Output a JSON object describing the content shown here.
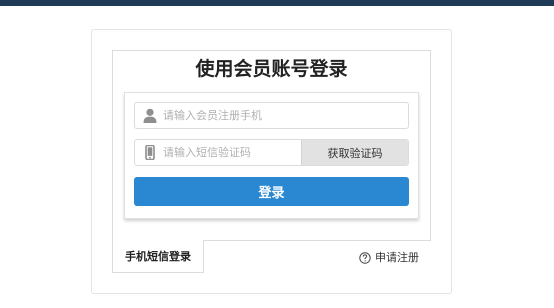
{
  "title": "使用会员账号登录",
  "phone_field": {
    "placeholder": "请输入会员注册手机",
    "icon": "user-icon"
  },
  "code_field": {
    "placeholder": "请输入短信验证码",
    "icon": "mobile-phone-icon"
  },
  "get_code_label": "获取验证码",
  "login_label": "登录",
  "tabs": [
    {
      "label": "手机短信登录",
      "active": true
    }
  ],
  "register": {
    "label": "申请注册",
    "icon": "question-circle-icon"
  },
  "colors": {
    "topbar": "#1f3a57",
    "primary": "#2a87d1",
    "code_button": "#e2e2e2"
  }
}
